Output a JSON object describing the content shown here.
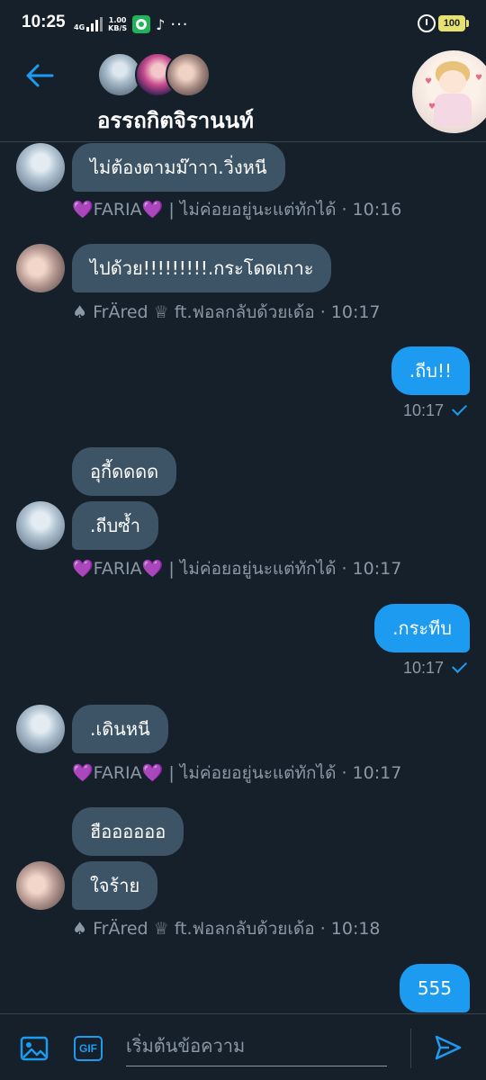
{
  "status_bar": {
    "time": "10:25",
    "network": "4G",
    "speed_value": "1.00",
    "speed_unit": "KB/S",
    "overflow": "···",
    "battery": "100"
  },
  "header": {
    "title": "อรรถกิตจิรานนท์"
  },
  "messages": {
    "m1": {
      "text": "ไม่ต้องตามม๊าาา.วิ่งหนี"
    },
    "m1_meta": {
      "heart_left": "💜",
      "name": "FARIA",
      "heart_right": "💜",
      "rest": " | ไม่ค่อยอยู่นะแต่ทักได้ · 10:16"
    },
    "m2": {
      "text": "ไปด้วย!!!!!!!!!.กระโดดเกาะ"
    },
    "m2_meta": {
      "spade": "♠",
      "name": "FrÄred ♕ ft.ฟอลกลับด้วยเด้อ · 10:17"
    },
    "m3": {
      "text": ".ถีบ!!",
      "time": "10:17"
    },
    "m4a": {
      "text": "อุกี้ดดดด"
    },
    "m4b": {
      "text": ".ถีบซ้ำ"
    },
    "m4_meta": {
      "heart_left": "💜",
      "name": "FARIA",
      "heart_right": "💜",
      "rest": " | ไม่ค่อยอยู่นะแต่ทักได้ · 10:17"
    },
    "m5": {
      "text": ".กระทีบ",
      "time": "10:17"
    },
    "m6": {
      "text": ".เดินหนี"
    },
    "m6_meta": {
      "heart_left": "💜",
      "name": "FARIA",
      "heart_right": "💜",
      "rest": " | ไม่ค่อยอยู่นะแต่ทักได้ · 10:17"
    },
    "m7a": {
      "text": "ฮืออออออ"
    },
    "m7b": {
      "text": "ใจร้าย"
    },
    "m7_meta": {
      "spade": "♠",
      "name": "FrÄred ♕ ft.ฟอลกลับด้วยเด้อ · 10:18"
    },
    "m8": {
      "text": "555"
    }
  },
  "composer": {
    "gif_label": "GIF",
    "placeholder": "เริ่มต้นข้อความ"
  },
  "colors": {
    "background": "#15202b",
    "incoming_bubble": "#3d5466",
    "outgoing_bubble": "#1d9bf0",
    "meta_text": "#8b98a5",
    "accent": "#1d9bf0"
  }
}
